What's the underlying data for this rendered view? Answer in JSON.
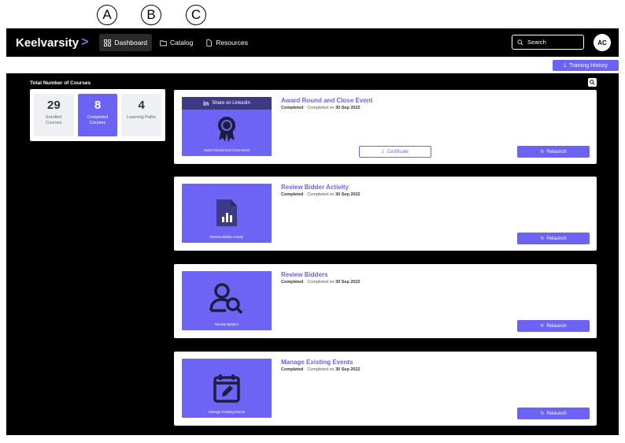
{
  "markers": [
    "A",
    "B",
    "C"
  ],
  "nav": {
    "brand": "Keelvarsity",
    "brand_chevron": ">",
    "items": [
      {
        "label": "Dashboard",
        "icon": "grid-icon",
        "active": true
      },
      {
        "label": "Catalog",
        "icon": "folder-icon",
        "active": false
      },
      {
        "label": "Resources",
        "icon": "document-icon",
        "active": false
      }
    ],
    "search_placeholder": "Search",
    "avatar_initials": "AC"
  },
  "toolbar": {
    "training_history_label": "Training History"
  },
  "stats": {
    "title": "Total Number of Courses",
    "items": [
      {
        "value": "29",
        "label": "Enrolled Courses",
        "active": false
      },
      {
        "value": "8",
        "label": "Completed Courses",
        "active": true
      },
      {
        "value": "4",
        "label": "Learning Paths",
        "active": false
      }
    ]
  },
  "courses": [
    {
      "title": "Award Round and Close Event",
      "status": "Completed",
      "completed_text": "Completed on",
      "date": "30 Sep 2022",
      "thumb_caption": "Award Round and Close Event",
      "icon": "award-ribbon-icon",
      "linkedin_label": "Share on LinkedIn",
      "certificate_label": "Certificate",
      "relaunch_label": "Relaunch"
    },
    {
      "title": "Review Bidder Activity",
      "status": "Completed",
      "completed_text": "Completed on",
      "date": "30 Sep 2022",
      "thumb_caption": "Review Bidder Activity",
      "icon": "document-chart-icon",
      "relaunch_label": "Relaunch"
    },
    {
      "title": "Review Bidders",
      "status": "Completed",
      "completed_text": "Completed on",
      "date": "30 Sep 2022",
      "thumb_caption": "Review Bidders",
      "icon": "user-search-icon",
      "relaunch_label": "Relaunch"
    },
    {
      "title": "Manage Existing Events",
      "status": "Completed",
      "completed_text": "Completed on",
      "date": "30 Sep 2022",
      "thumb_caption": "Manage Existing Events",
      "icon": "calendar-edit-icon",
      "relaunch_label": "Relaunch"
    }
  ],
  "colors": {
    "accent": "#6c63f5",
    "linkedin_bar": "#3d3a85",
    "background": "#000000"
  }
}
